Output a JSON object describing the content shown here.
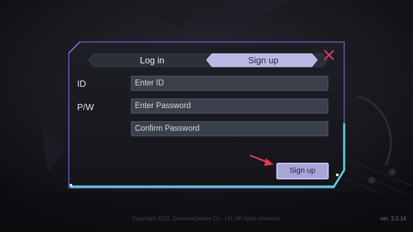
{
  "tabs": {
    "login_label": "Log in",
    "signup_label": "Sign up"
  },
  "form": {
    "id_label": "ID",
    "pw_label": "P/W",
    "id_placeholder": "Enter ID",
    "password_placeholder": "Enter Password",
    "confirm_placeholder": "Confirm Password",
    "submit_label": "Sign up"
  },
  "footer": {
    "copyright": "Copyright 2022. QueseraGames Co., Ltd. All rights reserved.",
    "version": "ver. 3.2.14"
  },
  "icons": {
    "close": "close-icon",
    "arrow": "pointer-arrow-icon"
  },
  "colors": {
    "frame_accent": "#5ad0d8",
    "frame_edge": "#7d6fd0",
    "active_tab": "#b9b8e6",
    "close_icon": "#e0465a",
    "arrow": "#e23a4a"
  }
}
